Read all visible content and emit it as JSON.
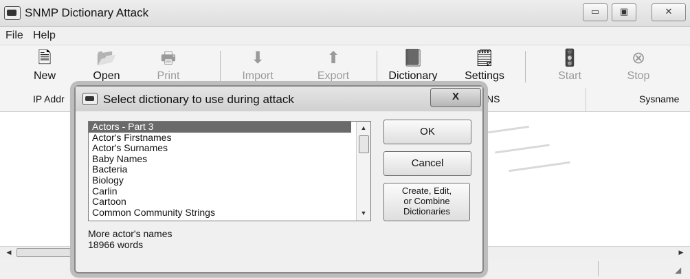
{
  "window": {
    "title": "SNMP Dictionary Attack"
  },
  "window_controls": {
    "minimize": "▭",
    "maximize": "▣",
    "close": "✕"
  },
  "menu": [
    "File",
    "Help"
  ],
  "toolbar": [
    {
      "label": "New",
      "icon": "new-icon",
      "glyph": "🗎",
      "enabled": true
    },
    {
      "label": "Open",
      "icon": "open-icon",
      "glyph": "📂",
      "enabled": true
    },
    {
      "label": "Print",
      "icon": "print-icon",
      "glyph": "🖶",
      "enabled": false
    },
    {
      "label": "Import",
      "icon": "import-icon",
      "glyph": "⬇",
      "enabled": false
    },
    {
      "label": "Export",
      "icon": "export-icon",
      "glyph": "⬆",
      "enabled": false
    },
    {
      "label": "Dictionary",
      "icon": "dictionary-icon",
      "glyph": "📕",
      "enabled": true
    },
    {
      "label": "Settings",
      "icon": "settings-icon",
      "glyph": "🗒",
      "enabled": true
    },
    {
      "label": "Start",
      "icon": "start-icon",
      "glyph": "🚦",
      "enabled": false
    },
    {
      "label": "Stop",
      "icon": "stop-icon",
      "glyph": "⊗",
      "enabled": false
    }
  ],
  "columns": {
    "ip_address": "IP Addr",
    "dns": "NS",
    "sysname": "Sysname"
  },
  "dialog": {
    "title": "Select dictionary to use during attack",
    "close_label": "X",
    "items": [
      "Actors - Part 3",
      "Actor's Firstnames",
      "Actor's Surnames",
      "Baby Names",
      "Bacteria",
      "Biology",
      "Carlin",
      "Cartoon",
      "Common Community Strings"
    ],
    "selected_index": 0,
    "description_line1": "More actor's names",
    "description_line2": "18966 words",
    "buttons": {
      "ok": "OK",
      "cancel": "Cancel",
      "create_line1": "Create, Edit,",
      "create_line2": "or Combine",
      "create_line3": "Dictionaries"
    }
  },
  "scrollbar": {
    "up": "▲",
    "down": "▼",
    "left": "◀",
    "right": "▶"
  }
}
